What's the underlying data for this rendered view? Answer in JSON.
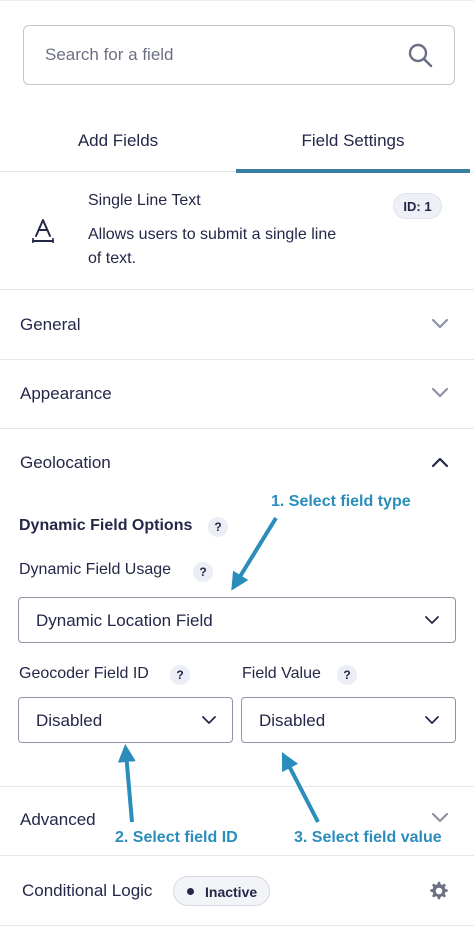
{
  "search": {
    "placeholder": "Search for a field"
  },
  "tabs": [
    {
      "label": "Add Fields",
      "active": false
    },
    {
      "label": "Field Settings",
      "active": true
    }
  ],
  "field": {
    "title": "Single Line Text",
    "description": "Allows users to submit a single line of text.",
    "id_badge": "ID: 1"
  },
  "sections": {
    "general": "General",
    "appearance": "Appearance",
    "geolocation": "Geolocation",
    "advanced": "Advanced"
  },
  "geolocation": {
    "dynamic_title": "Dynamic Field Options",
    "usage_label": "Dynamic Field Usage",
    "usage_value": "Dynamic Location Field",
    "geocoder_label": "Geocoder Field ID",
    "geocoder_value": "Disabled",
    "field_value_label": "Field Value",
    "field_value_value": "Disabled",
    "help_glyph": "?"
  },
  "annotations": {
    "step1": "1. Select field type",
    "step2": "2. Select field ID",
    "step3": "3. Select field value"
  },
  "conditional": {
    "label": "Conditional Logic",
    "status": "Inactive"
  },
  "colors": {
    "text": "#242748",
    "accent_tab": "#3a7ea3",
    "annotation": "#2b8dbb",
    "border": "#e4e6ec"
  },
  "icons": {
    "search": "search-icon",
    "field_type": "text-field-icon",
    "chevron": "chevron-icon",
    "settings": "gear-icon"
  }
}
